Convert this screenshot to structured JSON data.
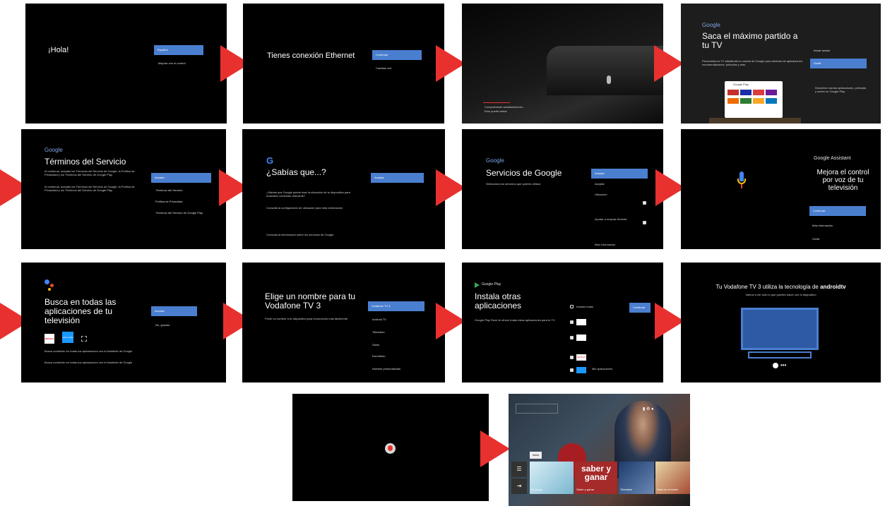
{
  "colors": {
    "arrow": "#e8312f",
    "button": "#4a7fd0",
    "panel": "#000000"
  },
  "p1": {
    "title": "¡Hola!",
    "btn": "Español",
    "opt": "Mejorar con el control"
  },
  "p2": {
    "title": "Tienes conexión Ethernet",
    "btn": "Continuar",
    "opt": "Cambiar red"
  },
  "p3": {
    "line1": "Comprobando actualizaciones...",
    "line2": "Esto puede tardar"
  },
  "p4": {
    "logo": "Google",
    "title": "Saca el máximo partido a tu TV",
    "desc": "Personaliza tu TV añadiendo tu cuenta de Google para disfrutar de aplicaciones, recomendaciones, películas y más",
    "opt": "Iniciar sesión",
    "btn": "Omitir",
    "side": "Descubre nuevas aplicaciones, películas y series en Google Play",
    "store": "Google Play"
  },
  "p5": {
    "logo": "Google",
    "title": "Términos del Servicio",
    "body": "Al continuar, aceptas los Términos del Servicio de Google, la Política de Privacidad y los Términos del Servicio de Google Play",
    "btn": "Aceptar",
    "opts": [
      "Términos del Servicio",
      "Política de Privacidad",
      "Términos del Servicio de Google Play"
    ]
  },
  "p6": {
    "logo": "G",
    "title": "¿Sabías que...?",
    "btn": "Aceptar",
    "body1": "¿Sabías que Google puede usar la ubicación de tu dispositivo para mostrarte contenido relevante?",
    "body2": "Consulta la configuración de ubicación para más información",
    "body3": "Consulta la información sobre los servicios de Google"
  },
  "p7": {
    "logo": "Google",
    "title": "Servicios de Google",
    "body": "Selecciona los servicios que quieres utilizar",
    "btn": "Aceptar",
    "opt0": "Aceptar",
    "items": [
      "Ubicación",
      "Ayudar a mejorar Android",
      "Más información"
    ]
  },
  "p8": {
    "brand": "Google Assistant",
    "title": "Mejora el control por voz de tu televisión",
    "btn": "Continuar",
    "opts": [
      "Más información",
      "Omitir"
    ]
  },
  "p9": {
    "title": "Busca en todas las aplicaciones de tu televisión",
    "btn": "Aceptar",
    "opt": "No, gracias",
    "apps": [
      "NETFLIX",
      "prime video"
    ],
    "body": "Busca contenido en todas tus aplicaciones con el Asistente de Google"
  },
  "p10": {
    "title": "Elige un nombre para tu Vodafone TV 3",
    "desc": "Ponle un nombre a tu dispositivo para reconocerlo más fácilmente",
    "btn": "Vodafone TV 3",
    "opts": [
      "Android TV",
      "Televisión",
      "Salón",
      "Dormitorio",
      "Nombre personalizado"
    ]
  },
  "p11": {
    "store": "Google Play",
    "title": "Instala otras aplicaciones",
    "desc": "Google Play Store te ofrece todas estas aplicaciones para tu TV",
    "btn": "Continuar",
    "check_all": "Instalar todas",
    "apps": [
      "NETFLIX",
      "Mis aplicaciones"
    ]
  },
  "p12": {
    "title_pre": "Tu Vodafone TV 3 utiliza la tecnología de",
    "brand": "androidtv",
    "sub": "Vamos a ver todo lo que puedes hacer con tu dispositivo"
  },
  "p14": {
    "tabs": [
      "Inicio"
    ],
    "cards": [
      "En juego",
      "Saber y ganar",
      "Telediario",
      "Pasó en el metro"
    ],
    "feature": "saber y ganar"
  }
}
